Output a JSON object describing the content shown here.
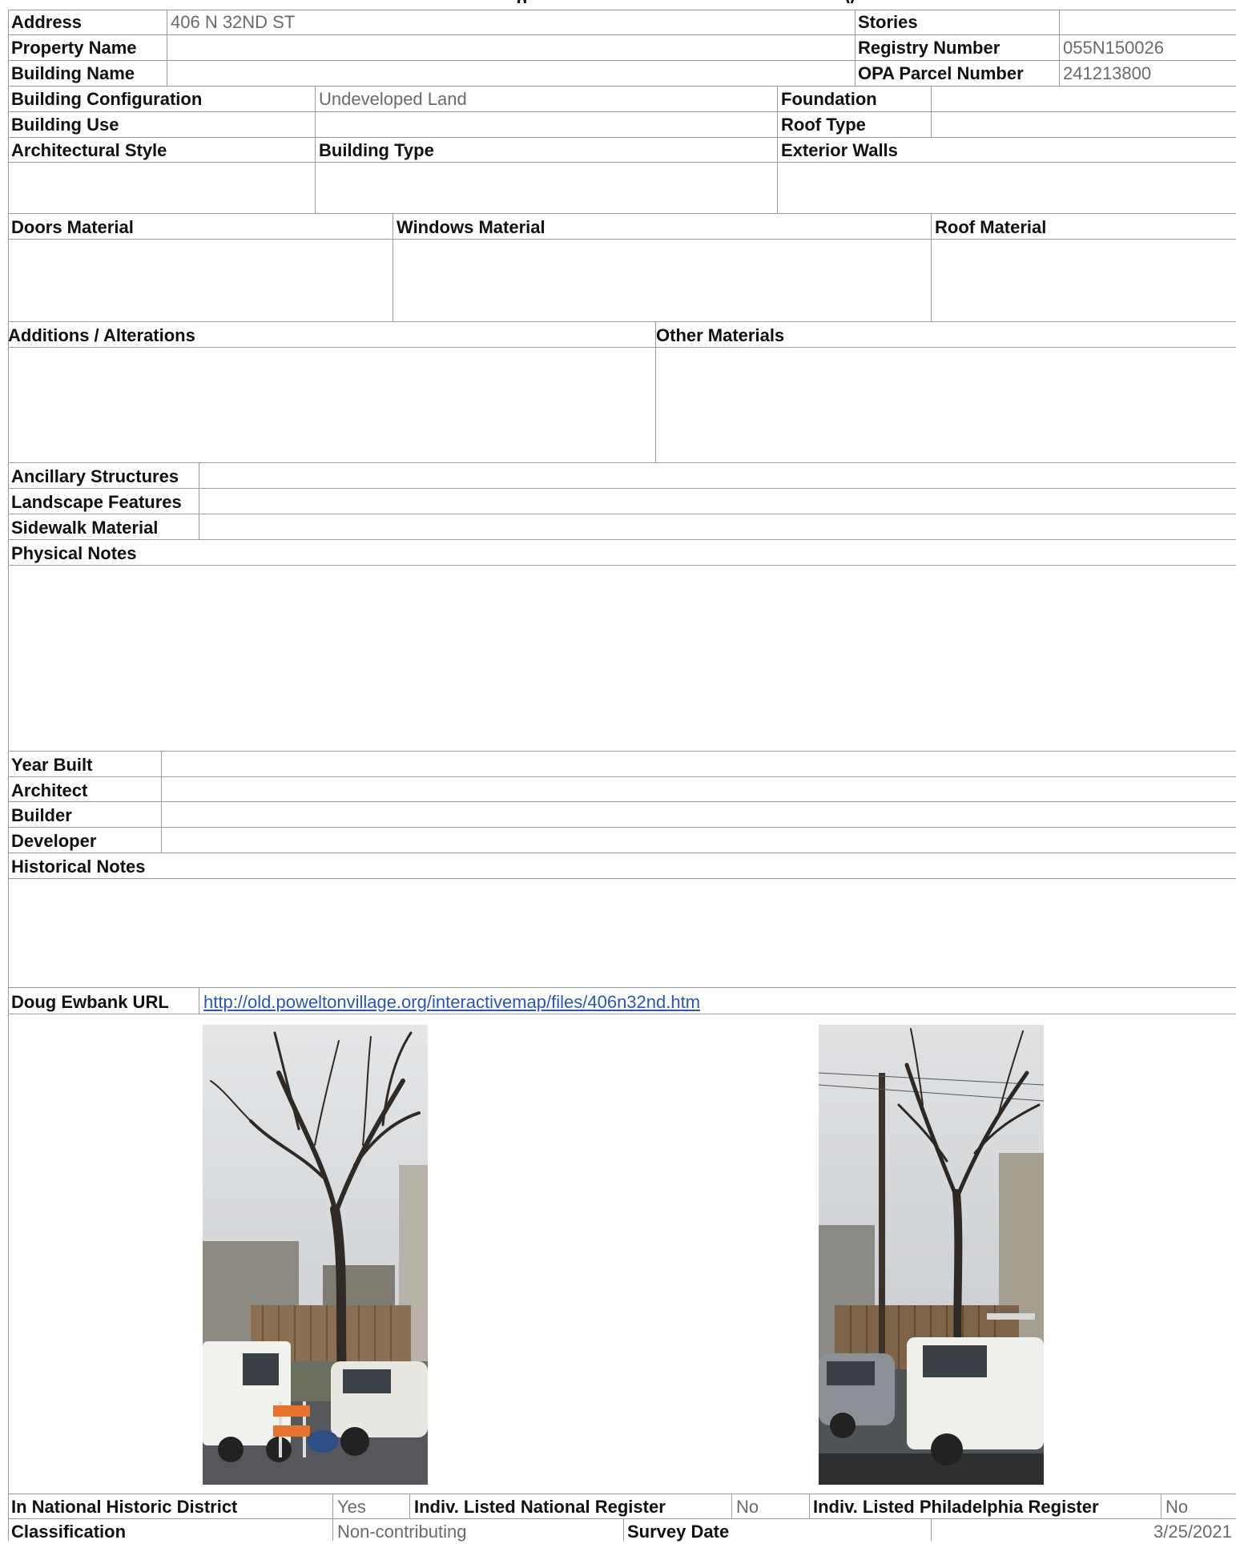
{
  "header": {
    "title_fragment": "g ... y"
  },
  "property": {
    "address_label": "Address",
    "address_value": "406 N 32ND ST",
    "property_name_label": "Property Name",
    "property_name_value": "",
    "building_name_label": "Building Name",
    "building_name_value": "",
    "stories_label": "Stories",
    "stories_value": "",
    "registry_label": "Registry Number",
    "registry_value": "055N150026",
    "opa_label": "OPA Parcel Number",
    "opa_value": "241213800"
  },
  "building": {
    "configuration_label": "Building Configuration",
    "configuration_value": "Undeveloped Land",
    "use_label": "Building Use",
    "use_value": "",
    "foundation_label": "Foundation",
    "foundation_value": "",
    "roof_type_label": "Roof Type",
    "roof_type_value": "",
    "arch_style_label": "Architectural Style",
    "building_type_label": "Building Type",
    "exterior_walls_label": "Exterior Walls"
  },
  "materials": {
    "doors_label": "Doors Material",
    "windows_label": "Windows Material",
    "roof_label": "Roof Material",
    "additions_label": "Additions / Alterations",
    "other_label": "Other Materials"
  },
  "site": {
    "ancillary_label": "Ancillary Structures",
    "landscape_label": "Landscape Features",
    "sidewalk_label": "Sidewalk Material",
    "physical_notes_label": "Physical Notes"
  },
  "history": {
    "year_built_label": "Year Built",
    "architect_label": "Architect",
    "builder_label": "Builder",
    "developer_label": "Developer",
    "historical_notes_label": "Historical Notes"
  },
  "ewbank": {
    "label": "Doug Ewbank URL",
    "url": "http://old.poweltonvillage.org/interactivemap/files/406n32nd.htm"
  },
  "register": {
    "national_district_label": "In National Historic District",
    "national_district_value": "Yes",
    "indiv_national_label": "Indiv. Listed National Register",
    "indiv_national_value": "No",
    "indiv_phila_label": "Indiv. Listed Philadelphia Register",
    "indiv_phila_value": "No",
    "classification_label": "Classification",
    "classification_value": "Non-contributing",
    "survey_date_label": "Survey Date",
    "survey_date_value": "3/25/2021"
  },
  "colors": {
    "border": "#9a9a9a",
    "label_text": "#111111",
    "value_text": "#6a6a6a",
    "link": "#2a55b8"
  }
}
